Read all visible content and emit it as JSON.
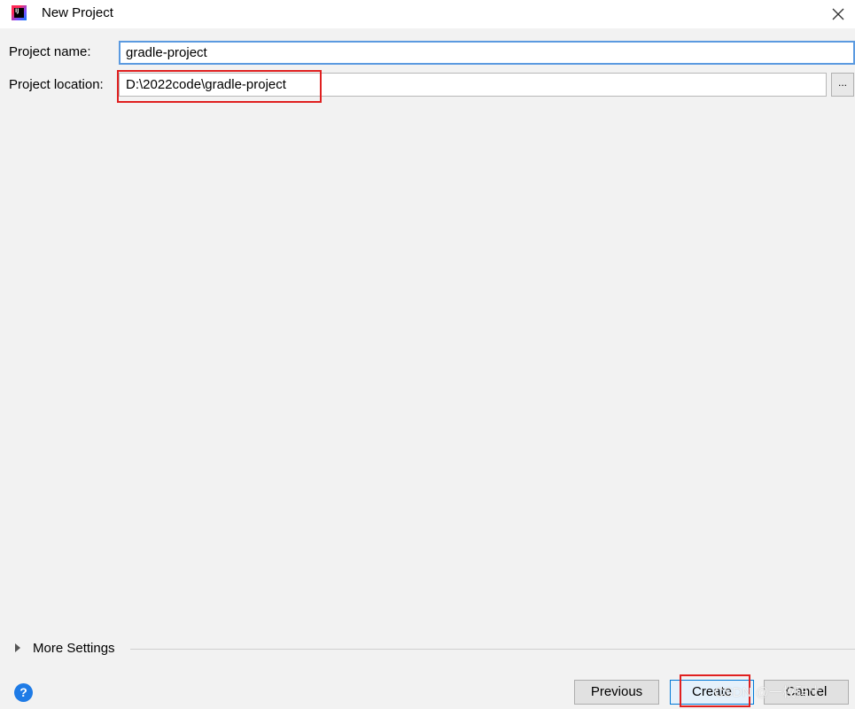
{
  "window": {
    "title": "New Project",
    "icon": "intellij-idea-icon",
    "icon_text": "IJ"
  },
  "form": {
    "project_name_label": "Project name:",
    "project_name_value": "gradle-project",
    "project_location_label": "Project location:",
    "project_location_value": "D:\\2022code\\gradle-project",
    "browse_label": "..."
  },
  "more_settings": {
    "label": "More Settings"
  },
  "footer": {
    "help_label": "?",
    "previous_label": "Previous",
    "create_label": "Create",
    "cancel_label": "Cancel"
  },
  "watermark": "CSDN @一枚码士",
  "colors": {
    "annotation": "#e02020",
    "focus": "#5b9ae0",
    "default_button_border": "#0078d7",
    "help": "#1e7be6"
  }
}
